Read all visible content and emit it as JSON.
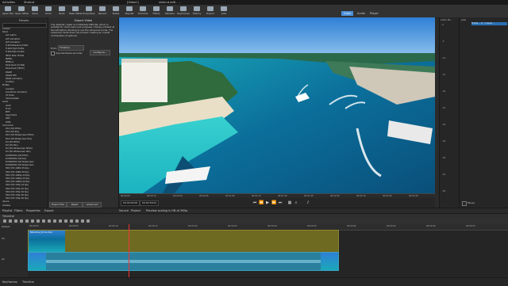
{
  "sysbar": {
    "activities": "Activities",
    "app": "Shotcut",
    "window1": "[Video1]",
    "window2": "shotcut-edit - ...",
    "clock": "",
    "right_status": ""
  },
  "toolbar": {
    "buttons": [
      {
        "label": "Open File",
        "icon": "folder-open-icon"
      },
      {
        "label": "Open Other",
        "icon": "folder-icon"
      },
      {
        "label": "Save",
        "icon": "save-icon"
      },
      {
        "label": "Undo",
        "icon": "undo-icon"
      },
      {
        "label": "Redo",
        "icon": "redo-icon"
      },
      {
        "label": "Peak Meter",
        "icon": "meter-icon"
      },
      {
        "label": "Properties",
        "icon": "properties-icon"
      },
      {
        "label": "Recent",
        "icon": "recent-icon"
      },
      {
        "label": "Notes",
        "icon": "notes-icon"
      },
      {
        "label": "Playlist",
        "icon": "playlist-icon"
      },
      {
        "label": "Timeline",
        "icon": "timeline-icon"
      },
      {
        "label": "Filters",
        "icon": "filters-icon"
      },
      {
        "label": "Markers",
        "icon": "markers-icon"
      },
      {
        "label": "Keyframes",
        "icon": "keyframes-icon"
      },
      {
        "label": "History",
        "icon": "history-icon"
      },
      {
        "label": "Export",
        "icon": "export-icon"
      },
      {
        "label": "Jobs",
        "icon": "jobs-icon"
      }
    ],
    "layouts": [
      "Color",
      "Audio",
      "Player"
    ],
    "layout_active": "Color"
  },
  "presets": {
    "title": "Presets",
    "search_placeholder": "",
    "items": [
      {
        "label": "Custom",
        "depth": 0
      },
      {
        "label": "Stock",
        "depth": 0
      },
      {
        "label": "av1 webm",
        "depth": 1
      },
      {
        "label": "GIF Animation",
        "depth": 1
      },
      {
        "label": "GIF Animation",
        "depth": 1
      },
      {
        "label": "H.264 Baseline Profile",
        "depth": 1
      },
      {
        "label": "H.264 High Profile",
        "depth": 1
      },
      {
        "label": "H.264 Main Profile",
        "depth": 1
      },
      {
        "label": "HEVC Main Profile",
        "depth": 1
      },
      {
        "label": "MJPEG",
        "depth": 1
      },
      {
        "label": "MPEG-2",
        "depth": 1
      },
      {
        "label": "Slide Deck (H.264)",
        "depth": 1
      },
      {
        "label": "Slide Deck (HEVC)",
        "depth": 1
      },
      {
        "label": "WebM",
        "depth": 1
      },
      {
        "label": "WebM VP9",
        "depth": 1
      },
      {
        "label": "WebP Animation",
        "depth": 1
      },
      {
        "label": "YouTube",
        "depth": 1
      },
      {
        "label": "ProRes",
        "depth": 0
      },
      {
        "label": "Lossless",
        "depth": 1
      },
      {
        "label": "Quicktime Animation",
        "depth": 1
      },
      {
        "label": "Ut Video",
        "depth": 1
      },
      {
        "label": "Intermediate",
        "depth": 1
      },
      {
        "label": "audio",
        "depth": 0
      },
      {
        "label": "ALAC",
        "depth": 1
      },
      {
        "label": "FLAC",
        "depth": 1
      },
      {
        "label": "MP3",
        "depth": 1
      },
      {
        "label": "Ogg Vorbis",
        "depth": 1
      },
      {
        "label": "WAV",
        "depth": 1
      },
      {
        "label": "WMA",
        "depth": 1
      },
      {
        "label": "camcorder",
        "depth": 0
      },
      {
        "label": "D10 (SD NTSC)",
        "depth": 1
      },
      {
        "label": "D10 (SD PAL)",
        "depth": 1
      },
      {
        "label": "D10 (SD Widescreen NTSC)",
        "depth": 1
      },
      {
        "label": "D10 (SD Widescreen PAL)",
        "depth": 1
      },
      {
        "label": "DV (SD NTSC)",
        "depth": 1
      },
      {
        "label": "DV (SD PAL)",
        "depth": 1
      },
      {
        "label": "DV (SD Widescreen NTSC)",
        "depth": 1
      },
      {
        "label": "DV (SD Widescreen PAL)",
        "depth": 1
      },
      {
        "label": "DVCPRO50 (SD NTSC)",
        "depth": 1
      },
      {
        "label": "DVCPRO50 (SD PAL)",
        "depth": 1
      },
      {
        "label": "DVCPRO50 (SD Widescreen",
        "depth": 1
      },
      {
        "label": "DVCPRO50 (SD Widescreen",
        "depth": 1
      },
      {
        "label": "HDV (HD 1080i 25 fps)",
        "depth": 1
      },
      {
        "label": "HDV (HD 1080i 30 fps)",
        "depth": 1
      },
      {
        "label": "HDV (HD 1080p 24 fps)",
        "depth": 1
      },
      {
        "label": "HDV (HD 1080p 25 fps)",
        "depth": 1
      },
      {
        "label": "HDV (HD 1080p 30 fps)",
        "depth": 1
      },
      {
        "label": "HDV (HD 720p 24 fps)",
        "depth": 1
      },
      {
        "label": "HDV (HD 720p 25 fps)",
        "depth": 1
      },
      {
        "label": "HDV (HD 720p 30 fps)",
        "depth": 1
      },
      {
        "label": "HDV (HD 720p 50 fps)",
        "depth": 1
      },
      {
        "label": "HDV (HD 720p 60 fps)",
        "depth": 1
      },
      {
        "label": "device",
        "depth": 0
      },
      {
        "label": "lossless",
        "depth": 0
      }
    ]
  },
  "export": {
    "title": "Export Video",
    "description": "The defaults create an H.264/AAC MP4 file, which is suitable for most users and purposes. Choose a Preset at the left before deciding to use the Advanced mode. The Advanced mode does not prevent creating an invalid combination of options!",
    "from_label": "From",
    "from_value": "Timeline",
    "hw_label": "Use hardware encoder",
    "configure_label": "Configure...",
    "buttons": {
      "export_file": "Export File",
      "reset": "Reset",
      "advanced": "Advanced"
    }
  },
  "player": {
    "ruler": [
      "00:00:00",
      "00:00:15",
      "00:00:30",
      "00:00:45",
      "00:01:00",
      "00:01:15",
      "00:01:30",
      "00:01:45",
      "00:02:00",
      "00:02:15",
      "00:02:30",
      "00:02:45"
    ],
    "timecode": "00:00:00:00",
    "duration": "00:02:59:01",
    "tabs": [
      "Source",
      "Project"
    ],
    "status": "Preview scaling is ON at 360p"
  },
  "meters": {
    "title": "Audio Pe...",
    "scale": [
      "0",
      "-5",
      "-10",
      "-15",
      "-20",
      "-25",
      "-30",
      "-35",
      "-40",
      "-45",
      "-50"
    ]
  },
  "props": {
    "title": "Jobs",
    "job_item": "Frame ... 0 : 1 input ...",
    "pause_label": "Pause"
  },
  "tabs_left": [
    "Playlist",
    "Filters",
    "Properties",
    "Export"
  ],
  "timeline": {
    "header": "Timeline",
    "output_label": "Output",
    "tracks": [
      {
        "name": "V1"
      },
      {
        "name": "A1"
      }
    ],
    "ruler": [
      "00:00:00",
      "00:00:05",
      "00:00:10",
      "00:00:15",
      "00:00:20",
      "00:00:25",
      "00:00:30",
      "00:00:35",
      "00:00:40",
      "00:00:45",
      "00:00:50",
      "00:00:55"
    ],
    "playhead_time": "00:00:05",
    "clip_name": "Bahamas_Drone.mp4"
  },
  "status_tabs": [
    "Keyframes",
    "Timeline"
  ]
}
